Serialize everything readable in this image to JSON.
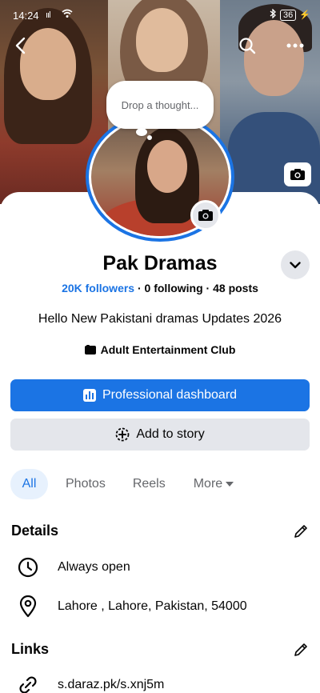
{
  "status_bar": {
    "time": "14:24",
    "signal": "ııl",
    "battery": "36"
  },
  "cover": {
    "thought_placeholder": "Drop a thought..."
  },
  "profile": {
    "name": "Pak Dramas",
    "followers": "20K followers",
    "following": "0 following",
    "posts": "48 posts",
    "separator": "·",
    "bio": "Hello New Pakistani dramas Updates 2026",
    "category": "Adult Entertainment Club"
  },
  "buttons": {
    "professional_dashboard": "Professional dashboard",
    "add_to_story": "Add to story"
  },
  "tabs": [
    {
      "label": "All",
      "active": true
    },
    {
      "label": "Photos",
      "active": false
    },
    {
      "label": "Reels",
      "active": false
    },
    {
      "label": "More",
      "active": false
    }
  ],
  "details": {
    "title": "Details",
    "hours": "Always open",
    "address": "Lahore , Lahore, Pakistan, 54000"
  },
  "links": {
    "title": "Links",
    "url": "s.daraz.pk/s.xnj5m"
  },
  "colors": {
    "accent": "#1b74e4",
    "button_grey": "#e4e6eb",
    "text": "#050505",
    "secondary_text": "#65676b"
  },
  "icons": {
    "back": "back-arrow-icon",
    "search": "search-icon",
    "more": "more-dots-icon",
    "camera": "camera-icon",
    "chevron": "chevron-down-icon",
    "category": "category-icon",
    "dashboard": "bar-chart-icon",
    "story": "add-story-icon",
    "edit": "pencil-icon",
    "clock": "clock-icon",
    "location": "location-pin-icon",
    "link": "link-icon"
  }
}
